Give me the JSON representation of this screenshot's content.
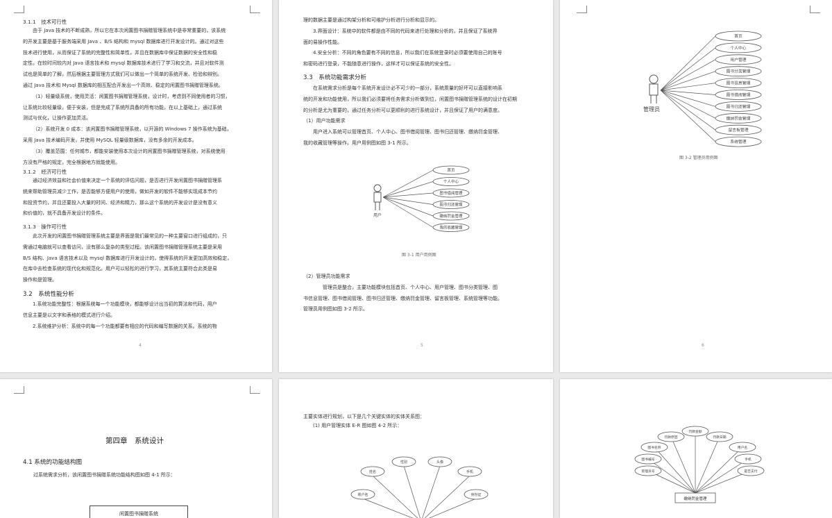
{
  "pages": {
    "p4": {
      "h311": "3.1.1　技术可行性",
      "para1": [
        "由于 Java 技术的不断成熟，所以它在本次闲置图书捐赠管理系统中是非常重要的，该系统",
        "的开发主要是基于服务端采用 Java 、B/S 结构和 mysql 数据库进行开发设计的。通过对这些",
        "技术进行使用，从而保证了系统的完整性和简单性，并且在数据库中保证数据的安全性和稳",
        "定性。在较时间较内对 Java 语言技术和 mysql 数据库技术进行了学习和交流，并且对软件测",
        "试也是简单的了解，然后根据主要管理方式我们可以做出一个简单的系统开发、检验和辩别。",
        "通过 Java 技术和 Mysql 数据库的相互配合开发出一个高效、稳定的闲置图书捐赠管理系统。"
      ],
      "para2": [
        "（1）轻量级系统，使用灵活：闲置图书捐赠管理系统，设计时，考虑到不同使用者的习惯，",
        "让系统比较轻量级，便于安装，但是完成了系统所具备的所有功能，在以上基础上，通过系统",
        "测试与优化，让操作更加灵活。"
      ],
      "para3": [
        "（2）系统开发 0 成本：该闲置图书捐赠管理系统，以开源的 Windows 7 操作系统为基础，",
        "采用 Java 技术编码开发，并使用 MySQL 轻量级数据库，没有多余的开发成本。"
      ],
      "para4": [
        "（3）覆盖范围：任何城市，都能安装使用本次设计的闲置图书捐赠管理系统，对系统使用",
        "方没有严格的规定，完全根据地方就能使用。"
      ],
      "h312": "3.1.2　经济可行性",
      "para5": [
        "通过经济效益和社会价值来决定一个系统的评估问题，是否进行开发闲置图书捐赠管理系",
        "统来帮助管理员减少工作，是否能够方便用户的使用，做如开发的软件不能够实现成本节约",
        "和投资节约，并且还要投入大量的时间、经济和精力，那么这个系统的开发设计是没有意义",
        "和价值的，就不具备开发设计的条件。"
      ],
      "h313": "3.1.3　操作可行性",
      "para6": [
        "此次开发的闲置图书捐赠管理系统主要是界面是我们最常见的一种主要窗口进行组成的，只",
        "需通过电脑就可以查看访问，没有那么复杂的类型过程。该闲置图书捐赠管理系统主要是采用",
        "B/S 结构、Java 语言技术以及 mysql 数据库进行开发设计的，使得系统的开发更加高效和稳定，",
        "在库中去检查系统的现代化和规范化。用户可以轻松的进行学习，其系统主要符合此类是易",
        "操作和是管理。"
      ],
      "h32": "3.2　系统性能分析",
      "para7": [
        "1.系统功能完整性：根据系统每一个功能模块，都能够设计出当初的算法和代码，用户",
        "信息主要是以文字和表格的模式进行介绍。"
      ],
      "para8": [
        "2.系统维护分析：系统中的每一个功能都要有相应的代码和编写数据的关系。系统的物"
      ],
      "pgnum": "4"
    },
    "p5": {
      "para0": [
        "理的数据主要是通过构架分析和可维护分析进行分析和显示的。"
      ],
      "para1": [
        "3.界面设计：系统中的软件都是由不同的代码来进行处理和分析的，并且保证了系统界",
        "面的易操作性能。"
      ],
      "para2": [
        "4.安全分析：不同的角色要有不同的信息，所以我们在系统登录时必须要使用自己的账号",
        "和密码进行登录，不能随意进行操作，这样才可以保证系统的安全性。"
      ],
      "h33": "3.3　系统功能需求分析",
      "para3": [
        "在系统需求分析是每个系统开发设计必不可少的一部分，系统质量的好坏可以直接影响系",
        "统的开发和功能使用，所以我们必须要将任务需求分析做到位，闲置图书捐赠管理系统的设计在初期",
        "的分析是尤为重要的，通过任务分析可以更顺利的进行系统设计，并且保证了用户的满意度。"
      ],
      "sub1": "（1）用户功能需求",
      "para4": [
        "用户进入系统可以管理首页、个人中心、图书借阅管理、图书归还管理、缴纳罚金管理、",
        "我的收藏管理等操作。用户用例图如图 3-1 所示。"
      ],
      "actor": "用户",
      "uses": [
        "首页",
        "个人中心",
        "图书借阅管理",
        "图书归还管理",
        "缴纳罚金管理",
        "我的收藏管理"
      ],
      "cap": "图 3-1 用户用例图",
      "sub2": "（2）管理员功能需求",
      "para5": [
        "管理员是整合，主要功能模块包括首页、个人中心、用户管理、图书分类管理、图",
        "书信息管理、图书借阅管理、图书归还管理、缴纳罚金管理、留言板管理、系统管理等功能。",
        "管理员用例图如图 3-2 所示。"
      ],
      "pgnum": "5"
    },
    "p6": {
      "actor": "管理员",
      "uses": [
        "首页",
        "个人中心",
        "用户管理",
        "图书分类管理",
        "图书信息管理",
        "图书借阅管理",
        "图书归还管理",
        "缴纳罚金管理",
        "留言板管理",
        "系统管理"
      ],
      "cap": "图 3-2 管理员用例图",
      "pgnum": "6"
    },
    "p7": {
      "chapter": "第四章　系统设计",
      "h41": "4.1 系统的功能结构图",
      "para1": [
        "过系统需求分析，该闲置图书捐赠系统功能结构图如图 4-1 所示："
      ],
      "box": "闲置图书捐赠系统"
    },
    "p8": {
      "line1": "主要实体进行规划，以下是几个关键实体的实体关系图：",
      "line2": "(1) 用户管理实体 E-R 图如图 4-2 所示：",
      "attrs": [
        "姓名",
        "性别",
        "头像",
        "手机",
        "账户名",
        "身份证"
      ]
    },
    "p9": {
      "entity": "缴纳罚金管理",
      "attrs": [
        "罚款金额",
        "罚款原因",
        "罚款日期",
        "图书名称",
        "用户名",
        "图书编号",
        "手机",
        "管理员号",
        "是否支付"
      ]
    }
  }
}
